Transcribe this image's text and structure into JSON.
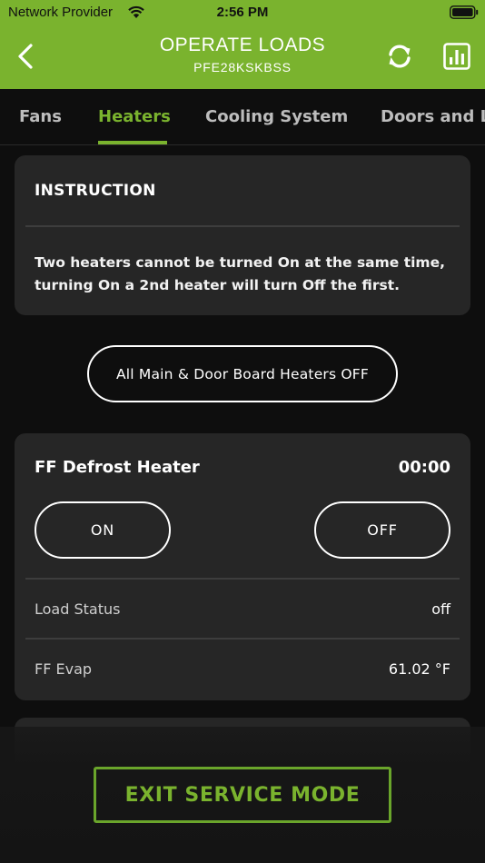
{
  "status_bar": {
    "carrier": "Network Provider",
    "time": "2:56 PM",
    "wifi_icon": "wifi-icon",
    "battery_icon": "battery-icon"
  },
  "header": {
    "title": "OPERATE LOADS",
    "subtitle": "PFE28KSKBSS",
    "back_icon": "chevron-left-icon",
    "refresh_icon": "refresh-icon",
    "chart_icon": "bar-chart-icon",
    "accent_color": "#7ab32e"
  },
  "tabs": [
    {
      "label": "Fans",
      "active": false
    },
    {
      "label": "Heaters",
      "active": true
    },
    {
      "label": "Cooling System",
      "active": false
    },
    {
      "label": "Doors and L",
      "active": false
    }
  ],
  "instruction": {
    "title": "INSTRUCTION",
    "text": "Two heaters cannot be turned On at the same time, turning On a 2nd heater will turn Off the first."
  },
  "all_off_button": "All Main & Door Board Heaters OFF",
  "heater": {
    "name": "FF Defrost Heater",
    "timer": "00:00",
    "on_label": "ON",
    "off_label": "OFF",
    "rows": [
      {
        "label": "Load Status",
        "value": "off"
      },
      {
        "label": "FF Evap",
        "value": "61.02 °F"
      }
    ]
  },
  "exit_button": "EXIT SERVICE MODE"
}
